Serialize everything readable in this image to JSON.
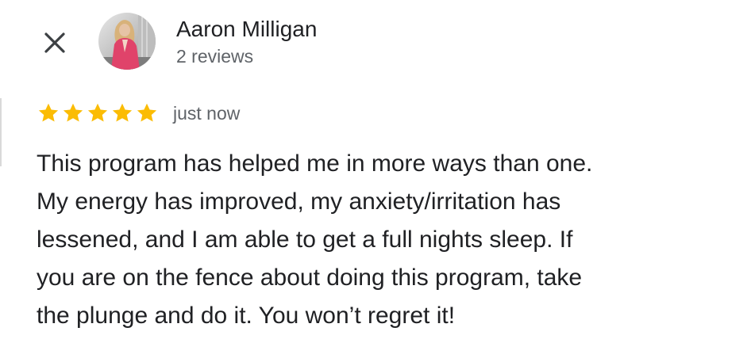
{
  "header": {
    "close_icon": "close-icon",
    "avatar_icon": "profile-photo",
    "author_name": "Aaron Milligan",
    "review_count": "2 reviews"
  },
  "rating": {
    "stars_filled": 5,
    "stars_total": 5,
    "star_color": "#fbbc04",
    "timestamp": "just now"
  },
  "review": {
    "lines": [
      "This program has helped me in more ways than one.",
      "My energy has improved, my anxiety/irritation has",
      "lessened, and I am able to get a full nights sleep. If",
      "you are on the fence about doing this program, take",
      "the plunge and do it. You won’t regret it!"
    ]
  },
  "colors": {
    "text_primary": "#202124",
    "text_secondary": "#5f6368",
    "background": "#ffffff"
  }
}
